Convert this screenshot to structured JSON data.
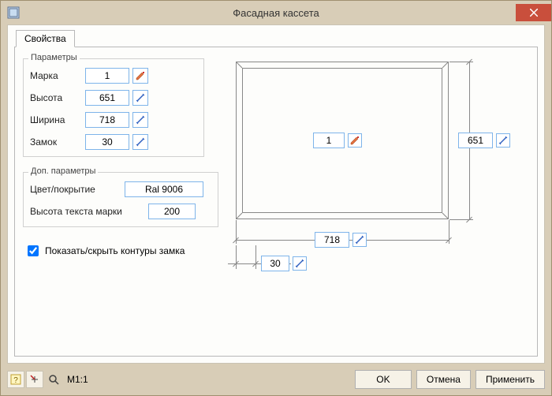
{
  "window": {
    "title": "Фасадная кассета"
  },
  "tabs": {
    "properties": "Свойства"
  },
  "params": {
    "legend": "Параметры",
    "mark_label": "Марка",
    "mark_value": "1",
    "height_label": "Высота",
    "height_value": "651",
    "width_label": "Ширина",
    "width_value": "718",
    "lock_label": "Замок",
    "lock_value": "30"
  },
  "extra": {
    "legend": "Доп. параметры",
    "color_label": "Цвет/покрытие",
    "color_value": "Ral 9006",
    "text_height_label": "Высота текста марки",
    "text_height_value": "200"
  },
  "checkbox": {
    "label": "Показать/скрыть контуры замка",
    "checked": true
  },
  "preview": {
    "mark_value": "1",
    "height_value": "651",
    "width_value": "718",
    "lock_value": "30"
  },
  "zoom": {
    "label": "М1:1"
  },
  "buttons": {
    "ok": "OK",
    "cancel": "Отмена",
    "apply": "Применить"
  }
}
